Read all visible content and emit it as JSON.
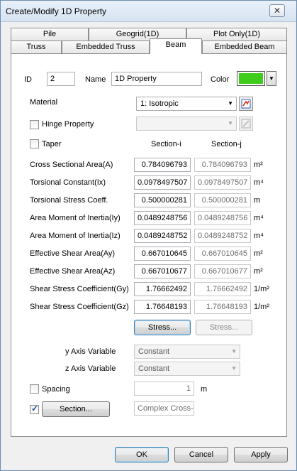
{
  "window": {
    "title": "Create/Modify 1D Property"
  },
  "tabs": {
    "row1": [
      "Pile",
      "Geogrid(1D)",
      "Plot Only(1D)"
    ],
    "row2": [
      "Truss",
      "Embedded Truss",
      "Beam",
      "Embedded Beam"
    ],
    "active": "Beam"
  },
  "header": {
    "id_label": "ID",
    "id_value": "2",
    "name_label": "Name",
    "name_value": "1D Property",
    "color_label": "Color",
    "color_value": "#3fcc1a"
  },
  "material": {
    "label": "Material",
    "value": "1: Isotropic"
  },
  "hinge": {
    "label": "Hinge Property",
    "checked": false,
    "value": ""
  },
  "taper": {
    "label": "Taper",
    "checked": false
  },
  "sections": {
    "i_label": "Section-i",
    "j_label": "Section-j"
  },
  "properties": [
    {
      "label": "Cross Sectional Area(A)",
      "i": "0.784096793",
      "j": "0.784096793",
      "unit": "m²"
    },
    {
      "label": "Torsional Constant(Ix)",
      "i": "0.0978497507",
      "j": "0.0978497507",
      "unit": "m⁴"
    },
    {
      "label": "Torsional Stress Coeff.",
      "i": "0.500000281",
      "j": "0.500000281",
      "unit": "m"
    },
    {
      "label": "Area Moment of Inertia(Iy)",
      "i": "0.0489248756",
      "j": "0.0489248756",
      "unit": "m⁴"
    },
    {
      "label": "Area Moment of Inertia(Iz)",
      "i": "0.0489248752",
      "j": "0.0489248752",
      "unit": "m⁴"
    },
    {
      "label": "Effective Shear Area(Ay)",
      "i": "0.667010645",
      "j": "0.667010645",
      "unit": "m²"
    },
    {
      "label": "Effective Shear Area(Az)",
      "i": "0.667010677",
      "j": "0.667010677",
      "unit": "m²"
    },
    {
      "label": "Shear Stress Coefficient(Gy)",
      "i": "1.76662492",
      "j": "1.76662492",
      "unit": "1/m²"
    },
    {
      "label": "Shear Stress Coefficient(Gz)",
      "i": "1.76648193",
      "j": "1.76648193",
      "unit": "1/m²"
    }
  ],
  "stress": {
    "i_button": "Stress...",
    "j_button": "Stress..."
  },
  "y_axis": {
    "label": "y Axis Variable",
    "value": "Constant"
  },
  "z_axis": {
    "label": "z Axis Variable",
    "value": "Constant"
  },
  "spacing": {
    "label": "Spacing",
    "checked": false,
    "value": "1",
    "unit": "m"
  },
  "section": {
    "checked": true,
    "button": "Section...",
    "value": "Complex Cross-S"
  },
  "footer": {
    "ok": "OK",
    "cancel": "Cancel",
    "apply": "Apply"
  }
}
